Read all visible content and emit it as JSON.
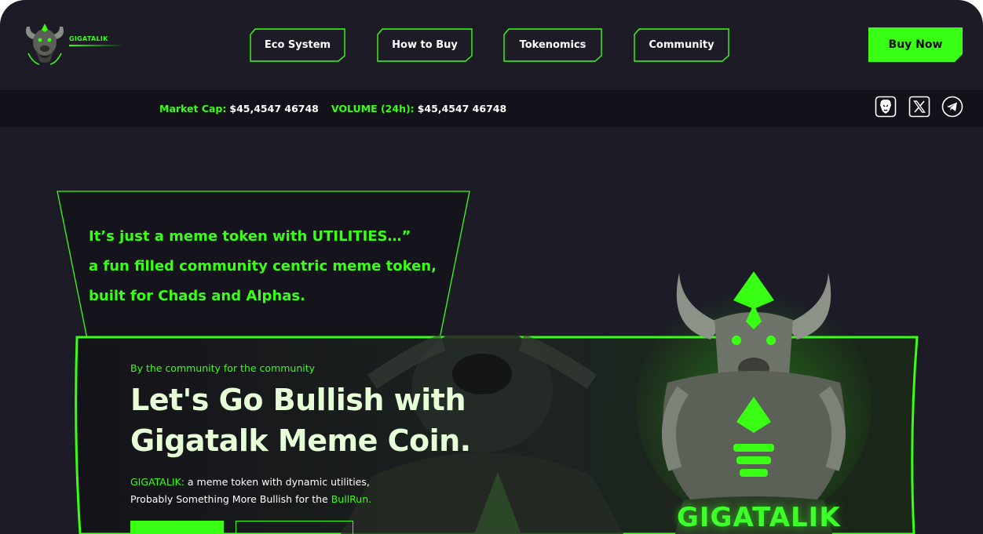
{
  "brand": {
    "name": "GIGATALIK",
    "accent": "#39ff14",
    "background": "#1c1b26",
    "ticker_background": "#13121a"
  },
  "nav": {
    "items": [
      {
        "label": "Eco System"
      },
      {
        "label": "How to Buy"
      },
      {
        "label": "Tokenomics"
      },
      {
        "label": "Community"
      }
    ],
    "cta_label": "Buy Now"
  },
  "ticker": {
    "market_cap_label": "Market Cap:",
    "market_cap_value": "$45,4547 46748",
    "volume_label": "VOLUME (24h):",
    "volume_value": "$45,4547 46748"
  },
  "social": {
    "icons": [
      "brave-lion-icon",
      "x-twitter-icon",
      "telegram-icon"
    ]
  },
  "tagline": {
    "lines": [
      "It’s just a meme token with UTILITIES…”",
      "a fun filled community centric meme token,",
      "built for Chads and Alphas."
    ]
  },
  "hero": {
    "eyebrow": "By the community for the community",
    "title_lines": [
      "Let's Go Bullish with",
      "Gigatalk Meme Coin."
    ],
    "desc_line1_highlight": "GIGATALIK:",
    "desc_line1_rest": " a meme token with dynamic utilities,",
    "desc_line2_rest": "Probably Something More Bullish for the ",
    "desc_line2_highlight": "BullRun.",
    "mascot_word": "GIGATALIK"
  }
}
